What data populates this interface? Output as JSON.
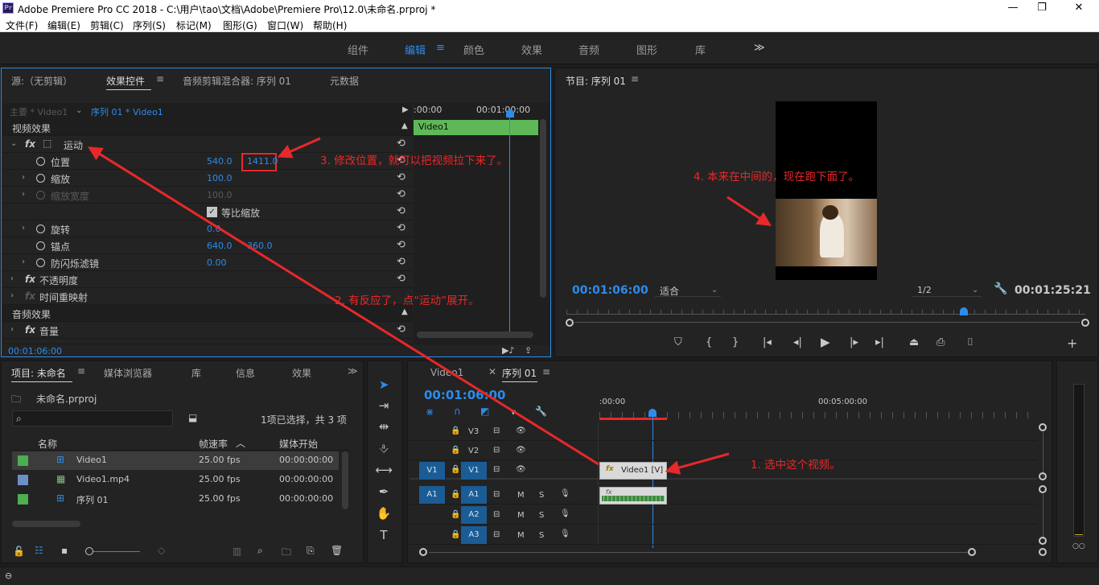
{
  "window": {
    "title": "Adobe Premiere Pro CC 2018 - C:\\用户\\tao\\文档\\Adobe\\Premiere Pro\\12.0\\未命名.prproj *",
    "logo": "Pr"
  },
  "menu": [
    "文件(F)",
    "编辑(E)",
    "剪辑(C)",
    "序列(S)",
    "标记(M)",
    "图形(G)",
    "窗口(W)",
    "帮助(H)"
  ],
  "workspaces": {
    "items": [
      "组件",
      "编辑",
      "颜色",
      "效果",
      "音频",
      "图形",
      "库"
    ],
    "active": "编辑",
    "more": "≫"
  },
  "effect_panel": {
    "tabs": [
      "源:（无剪辑）",
      "效果控件",
      "音频剪辑混合器: 序列 01",
      "元数据"
    ],
    "master": "主要 * Video1",
    "clip": "序列 01 * Video1",
    "timecode_start": ":00:00",
    "timecode_mid": "00:01:00:00",
    "clip_bar": "Video1",
    "video_header": "视频效果",
    "motion_label": "运动",
    "position_label": "位置",
    "position_x": "540.0",
    "position_y": "1411.0",
    "scale_label": "缩放",
    "scale_value": "100.0",
    "scale_width_label": "缩放宽度",
    "scale_width_value": "100.0",
    "uniform_label": "等比缩放",
    "rotation_label": "旋转",
    "rotation_value": "0.0",
    "anchor_label": "锚点",
    "anchor_x": "640.0",
    "anchor_y": "360.0",
    "antiflicker_label": "防闪烁滤镜",
    "antiflicker_value": "0.00",
    "opacity_label": "不透明度",
    "time_remap_label": "时间重映射",
    "audio_header": "音频效果",
    "volume_label": "音量",
    "footer_time": "00:01:06:00"
  },
  "program": {
    "title": "节目: 序列 01",
    "timecode": "00:01:06:00",
    "fit": "适合",
    "resolution": "1/2",
    "duration": "00:01:25:21"
  },
  "project": {
    "tabs": [
      "项目: 未命名",
      "媒体浏览器",
      "库",
      "信息",
      "效果"
    ],
    "file": "未命名.prproj",
    "selection_info": "1项已选择，共 3 项",
    "columns": [
      "名称",
      "帧速率",
      "媒体开始"
    ],
    "rows": [
      {
        "color": "#4caf50",
        "name": "Video1",
        "fps": "25.00 fps",
        "start": "00:00:00:00"
      },
      {
        "color": "#6b8fc7",
        "name": "Video1.mp4",
        "fps": "25.00 fps",
        "start": "00:00:00:00"
      },
      {
        "color": "#4caf50",
        "name": "序列 01",
        "fps": "25.00 fps",
        "start": "00:00:00:00"
      }
    ]
  },
  "timeline": {
    "tabs": [
      "Video1",
      "序列 01"
    ],
    "timecode": "00:01:06:00",
    "ruler_start": ":00:00",
    "ruler_mid": "00:05:00:00",
    "tracks": [
      {
        "src": "",
        "name": "V3"
      },
      {
        "src": "",
        "name": "V2"
      },
      {
        "src": "V1",
        "name": "V1"
      },
      {
        "src": "A1",
        "name": "A1"
      },
      {
        "src": "",
        "name": "A2"
      },
      {
        "src": "",
        "name": "A3"
      }
    ],
    "video_clip": "Video1 [V]",
    "mute": "M",
    "solo": "S"
  },
  "annotations": {
    "a1": "1.  选中这个视频。",
    "a2": "2.  有反应了，点“运动”展开。",
    "a3": "3.  修改位置，就可以把视频拉下来了。",
    "a4": "4.  本来在中间的，现在跑下面了。"
  },
  "colors": {
    "accent": "#2d8ceb",
    "annotation": "#e8282a",
    "panel": "#232323",
    "bg": "#1d1d1d"
  }
}
